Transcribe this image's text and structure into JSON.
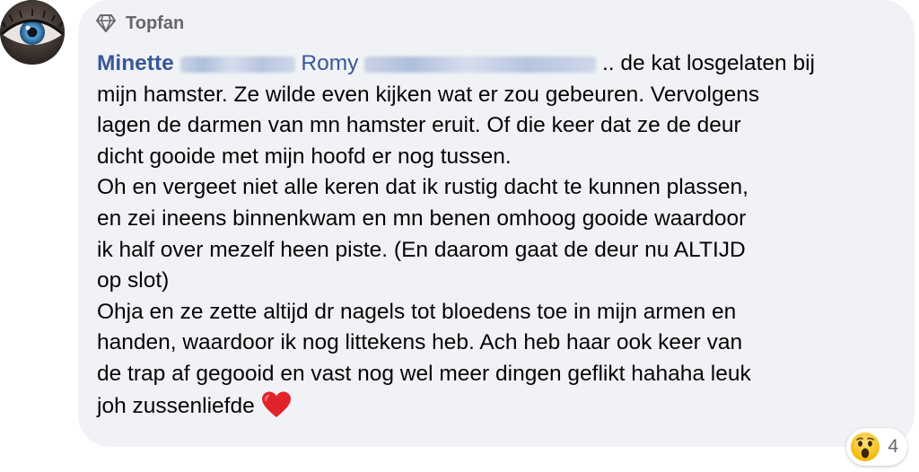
{
  "comment": {
    "badge_label": "Topfan",
    "author_name": "Minette",
    "mention_name": "Romy",
    "lines": [
      ".. de kat losgelaten bij",
      "mijn hamster. Ze wilde even kijken wat er zou gebeuren. Vervolgens",
      "lagen de darmen van mn hamster eruit. Of die keer dat ze de deur",
      "dicht gooide met mijn hoofd er nog tussen.",
      "Oh en vergeet niet alle keren dat ik rustig dacht te kunnen plassen,",
      "en zei ineens binnenkwam en mn benen omhoog gooide waardoor",
      "ik half over mezelf heen piste. (En daarom gaat de deur nu ALTIJD",
      "op slot)",
      "Ohja en ze zette altijd dr nagels tot bloedens toe in mijn armen en",
      "handen, waardoor ik nog littekens heb. Ach heb haar ook keer van",
      "de trap af gegooid en vast nog wel meer dingen geflikt hahaha leuk",
      "joh zussenliefde"
    ],
    "end_emoji": "red-heart-icon"
  },
  "reactions": {
    "emoji": "wow-face-icon",
    "count": "4"
  },
  "colors": {
    "bubble_background": "#f0f2f5",
    "name_link": "#385898",
    "badge_text": "#65676b",
    "body_text": "#050505"
  }
}
